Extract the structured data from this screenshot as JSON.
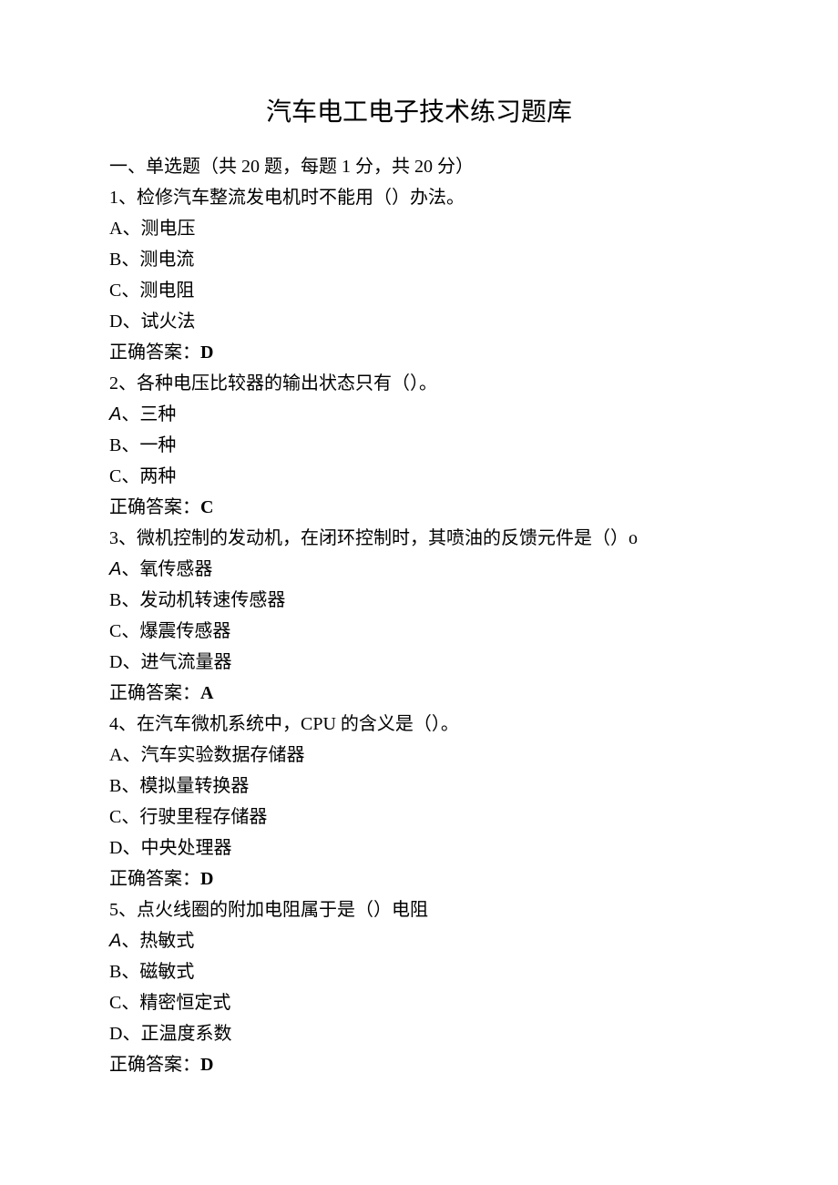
{
  "title": "汽车电工电子技术练习题库",
  "section_header": "一、单选题（共 20 题，每题 1 分，共 20 分）",
  "answer_label": "正确答案：",
  "questions": [
    {
      "num": "1、",
      "text": "检修汽车整流发电机时不能用（）办法。",
      "options": [
        {
          "letter": "A、",
          "text": "测电压",
          "letter_style": "normal"
        },
        {
          "letter": "B、",
          "text": "测电流",
          "letter_style": "normal"
        },
        {
          "letter": "C、",
          "text": "测电阻",
          "letter_style": "normal"
        },
        {
          "letter": "D、",
          "text": "试火法",
          "letter_style": "normal"
        }
      ],
      "answer": "D"
    },
    {
      "num": "2、",
      "text": "各种电压比较器的输出状态只有（）。",
      "options": [
        {
          "letter": "A",
          "suffix": "、",
          "text": "三种",
          "letter_style": "sans"
        },
        {
          "letter": "B、",
          "text": "一种",
          "letter_style": "normal"
        },
        {
          "letter": "C、",
          "text": "两种",
          "letter_style": "normal"
        }
      ],
      "answer": "C"
    },
    {
      "num": "3、",
      "text": "微机控制的发动机，在闭环控制时，其喷油的反馈元件是（）o",
      "options": [
        {
          "letter": "A",
          "suffix": "、",
          "text": "氧传感器",
          "letter_style": "sans"
        },
        {
          "letter": "B、",
          "text": "发动机转速传感器",
          "letter_style": "normal"
        },
        {
          "letter": "C、",
          "text": "爆震传感器",
          "letter_style": "normal"
        },
        {
          "letter": "D、",
          "text": "进气流量器",
          "letter_style": "normal"
        }
      ],
      "answer": "A"
    },
    {
      "num": "4、",
      "text": "在汽车微机系统中，CPU 的含义是（）。",
      "options": [
        {
          "letter": "A、",
          "text": "汽车实验数据存储器",
          "letter_style": "normal"
        },
        {
          "letter": "B、",
          "text": "模拟量转换器",
          "letter_style": "normal"
        },
        {
          "letter": "C、",
          "text": "行驶里程存储器",
          "letter_style": "normal"
        },
        {
          "letter": "D、",
          "text": "中央处理器",
          "letter_style": "normal"
        }
      ],
      "answer": "D"
    },
    {
      "num": "5、",
      "text": "点火线圈的附加电阻属于是（）电阻",
      "options": [
        {
          "letter": "A",
          "suffix": "、",
          "text": "热敏式",
          "letter_style": "sans"
        },
        {
          "letter": "B、",
          "text": "磁敏式",
          "letter_style": "normal"
        },
        {
          "letter": "C、",
          "text": "精密恒定式",
          "letter_style": "normal"
        },
        {
          "letter": "D、",
          "text": "正温度系数",
          "letter_style": "normal"
        }
      ],
      "answer": "D"
    }
  ]
}
